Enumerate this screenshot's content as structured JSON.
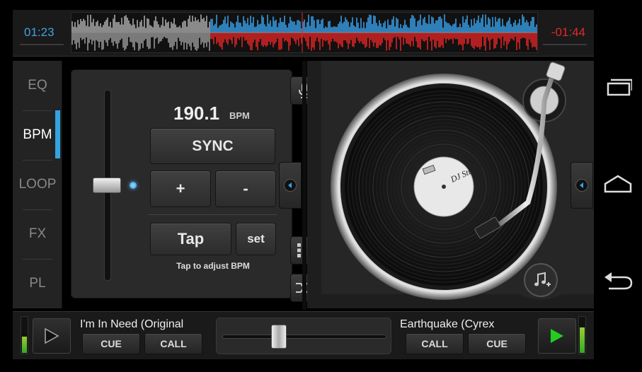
{
  "header": {
    "time_elapsed": "01:23",
    "time_remaining": "-01:44"
  },
  "sidebar": {
    "items": [
      {
        "label": "EQ"
      },
      {
        "label": "BPM"
      },
      {
        "label": "LOOP"
      },
      {
        "label": "FX"
      },
      {
        "label": "PL"
      }
    ],
    "active": "BPM"
  },
  "bpm_panel": {
    "bpm_value": "190.1",
    "bpm_unit": "BPM",
    "sync_label": "SYNC",
    "plus_label": "+",
    "minus_label": "-",
    "tap_label": "Tap",
    "set_label": "set",
    "hint": "Tap to adjust BPM",
    "pitch_fader_level": 0.5
  },
  "deck": {
    "record_label_text": "DJ Studio"
  },
  "bottom": {
    "left_track": "I'm In Need (Original",
    "right_track": "Earthquake (Cyrex",
    "cue_label": "CUE",
    "call_label": "CALL",
    "crossfader_position": 0.34,
    "left_meter_level": 0.45,
    "right_meter_level": 0.7
  },
  "colors": {
    "accent_blue": "#33a3e0",
    "time_red": "#e02a2a",
    "wave_blue": "#2f7fb8",
    "wave_red": "#b02020",
    "play_green": "#22cc22"
  },
  "icons": [
    "microphone-icon",
    "grid-icon",
    "shuffle-icon",
    "arrow-left-icon",
    "music-add-icon",
    "play-icon",
    "recent-apps-icon",
    "home-icon",
    "back-icon"
  ]
}
